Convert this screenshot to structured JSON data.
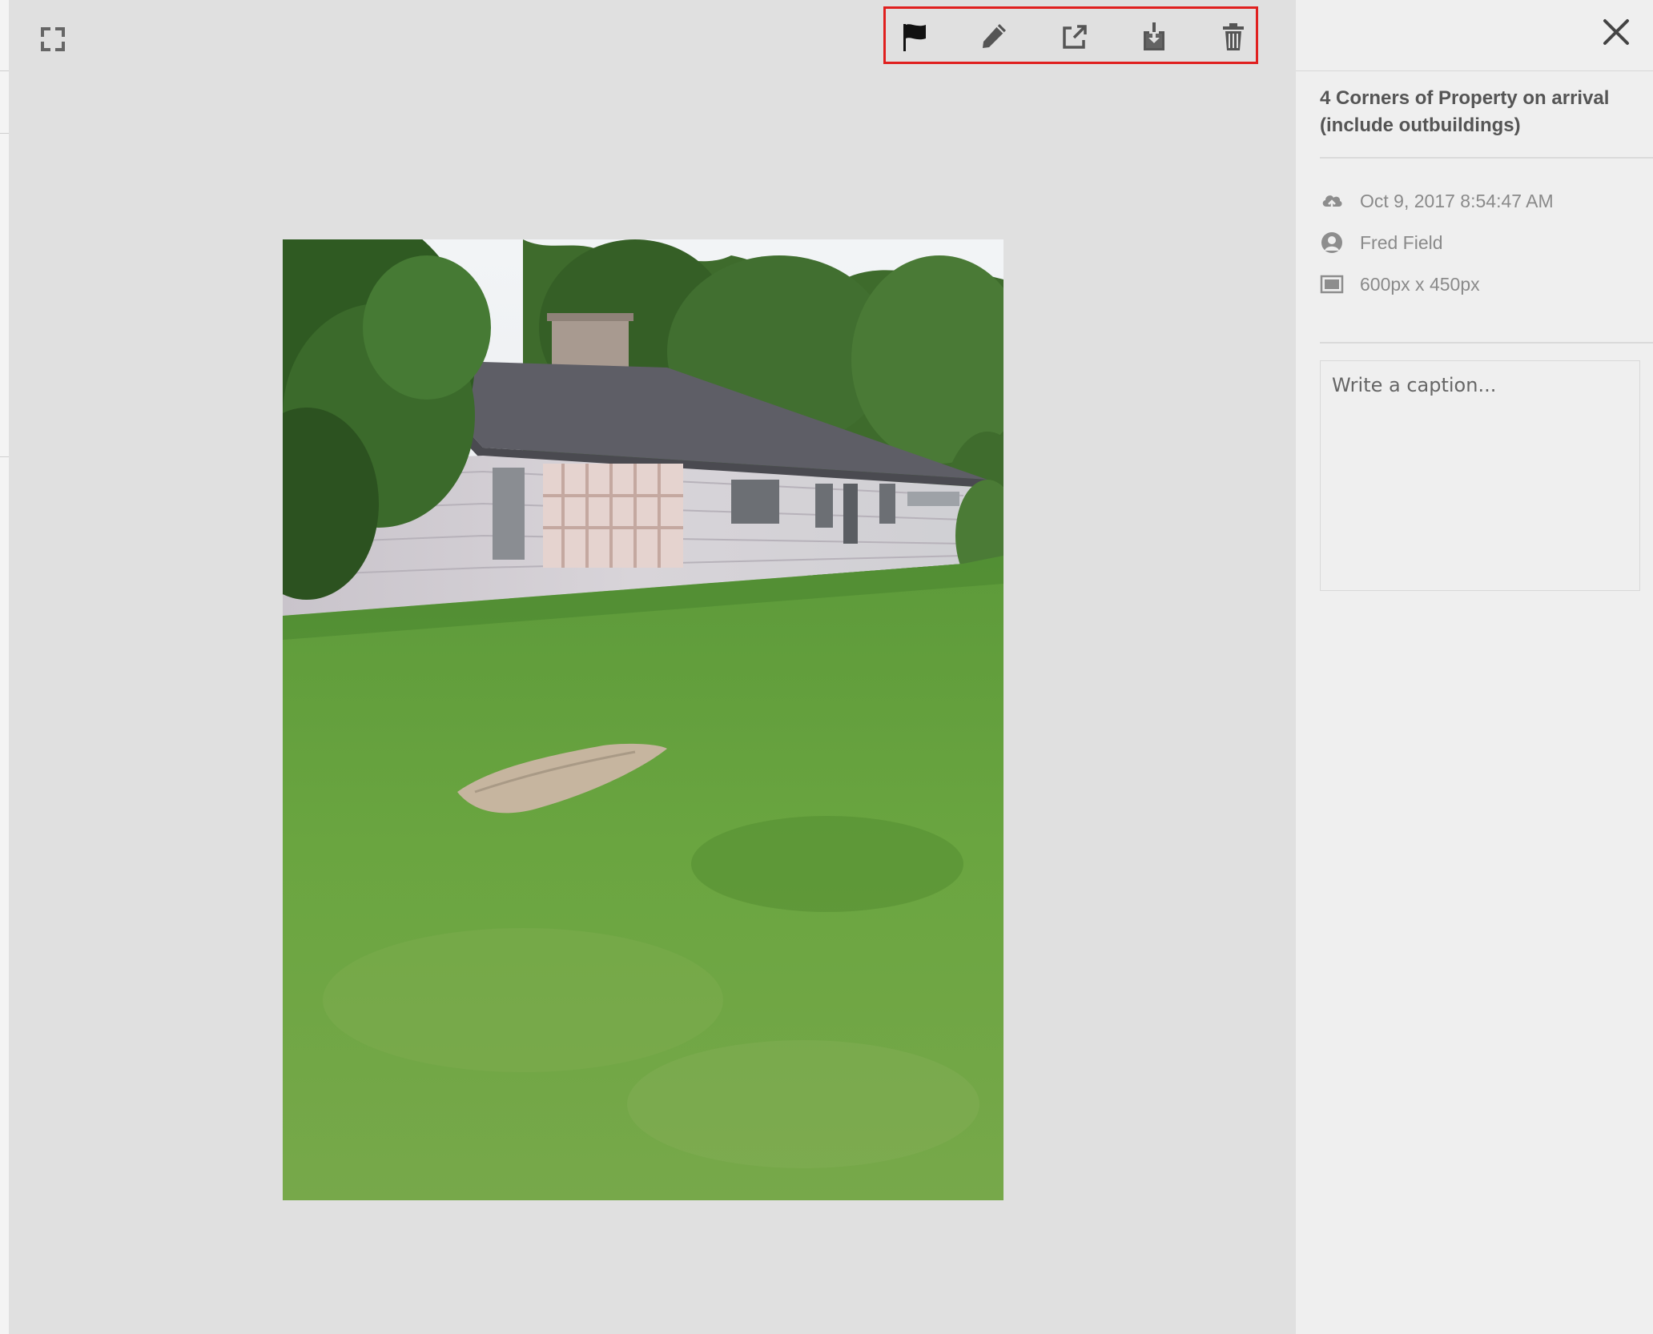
{
  "viewer": {
    "expand_icon": "fullscreen-icon",
    "toolbar": [
      {
        "name": "flag",
        "icon": "flag-icon"
      },
      {
        "name": "edit",
        "icon": "pencil-icon"
      },
      {
        "name": "open-external",
        "icon": "external-link-icon"
      },
      {
        "name": "download",
        "icon": "download-icon"
      },
      {
        "name": "delete",
        "icon": "trash-icon"
      }
    ],
    "highlight_color": "#e0201f"
  },
  "panel": {
    "close_icon": "close-icon",
    "title": "4 Corners of Property on arrival (include outbuildings)",
    "meta": {
      "uploaded": "Oct 9, 2017 8:54:47 AM",
      "author": "Fred Field",
      "dimensions": "600px x 450px"
    },
    "caption_placeholder": "Write a caption..."
  }
}
